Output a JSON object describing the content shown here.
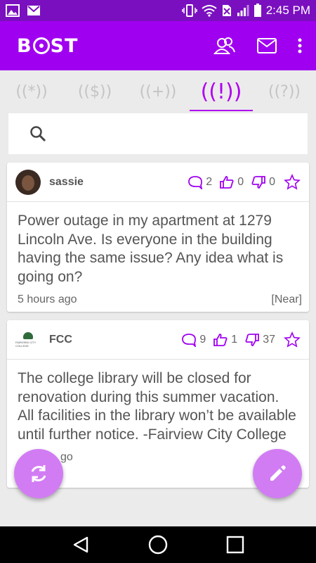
{
  "status_bar": {
    "time": "2:45 PM"
  },
  "app": {
    "logo_text_left": "B",
    "logo_text_right": "ST"
  },
  "tabs": [
    {
      "label": "((*))",
      "icon": "all-broadcast-icon"
    },
    {
      "label": "(($))",
      "icon": "money-broadcast-icon"
    },
    {
      "label": "((+))",
      "icon": "plus-broadcast-icon"
    },
    {
      "label": "((!))",
      "icon": "alert-broadcast-icon",
      "active": true
    },
    {
      "label": "((?))",
      "icon": "question-broadcast-icon"
    }
  ],
  "posts": [
    {
      "author": "sassie",
      "comments": "2",
      "likes": "0",
      "dislikes": "0",
      "text": "Power outage in my apartment at 1279 Lincoln Ave. Is everyone in the building having the same issue? Any idea what is going on?",
      "time": "5 hours ago",
      "tag": "[Near]"
    },
    {
      "author": "FCC",
      "avatar_text": "FAIRVIEW CITY COLLEGE",
      "comments": "9",
      "likes": "1",
      "dislikes": "37",
      "text": "The college library will be closed for renovation during this summer vacation. All facilities in the library won’t be available until further notice. -Fairview City College",
      "time": "go"
    }
  ],
  "colors": {
    "primary": "#a000f0",
    "status": "#7a0fbf",
    "accent": "#b000f0",
    "fab": "#d27cf4"
  }
}
